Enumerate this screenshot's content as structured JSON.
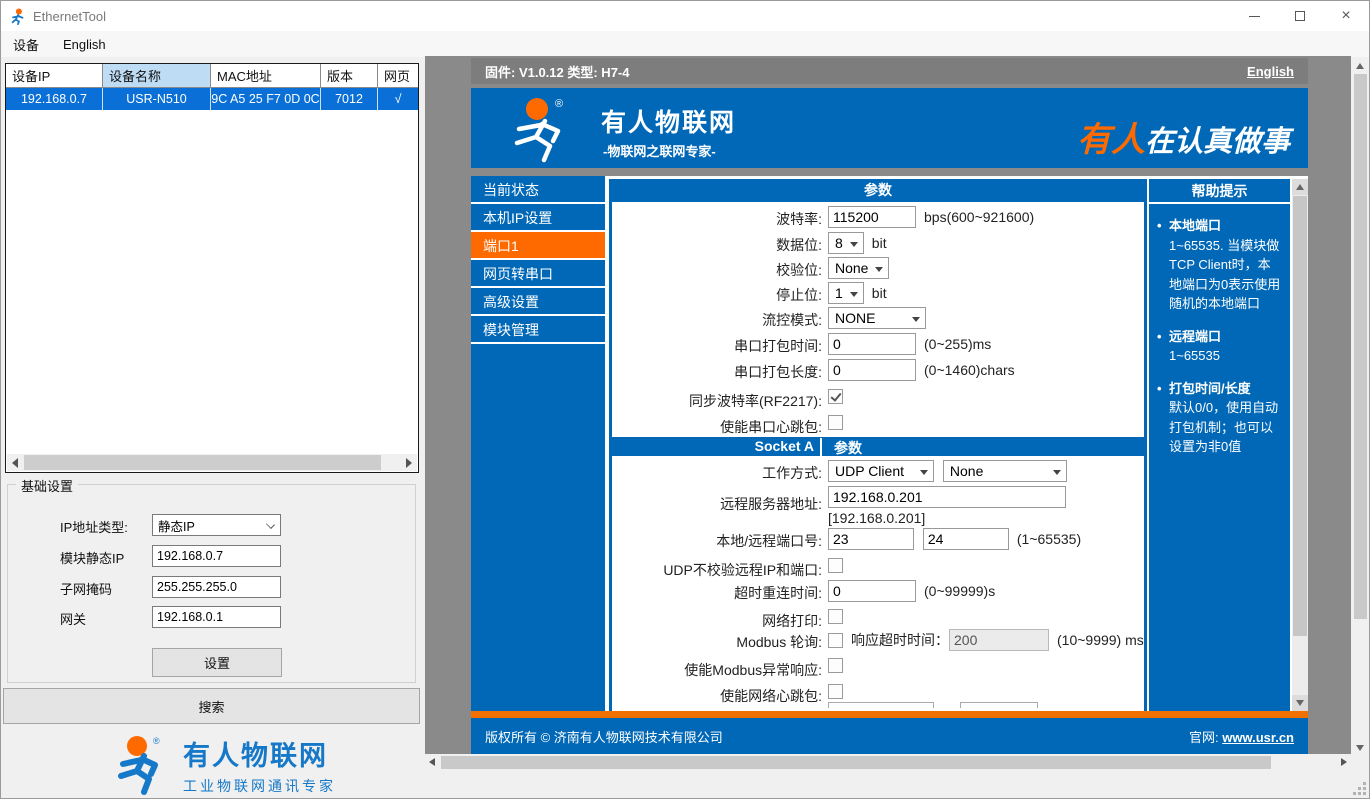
{
  "window": {
    "title": "EthernetTool",
    "menu": {
      "device": "设备",
      "english": "English"
    }
  },
  "device_table": {
    "headers": [
      "设备IP",
      "设备名称",
      "MAC地址",
      "版本",
      "网页"
    ],
    "row": {
      "ip": "192.168.0.7",
      "name": "USR-N510",
      "mac": "9C A5 25 F7 0D 0C",
      "version": "7012",
      "web": "√"
    }
  },
  "basic": {
    "title": "基础设置",
    "ip_type": {
      "label": "IP地址类型:",
      "value": "静态IP"
    },
    "static_ip": {
      "label": "模块静态IP",
      "value": "192.168.0.7"
    },
    "mask": {
      "label": "子网掩码",
      "value": "255.255.255.0"
    },
    "gateway": {
      "label": "网关",
      "value": "192.168.0.1"
    },
    "set_button": "设置",
    "search_button": "搜索",
    "logo": {
      "brand": "有人物联网",
      "tagline": "工业物联网通讯专家"
    }
  },
  "page": {
    "topbar": {
      "firmware": "固件: V1.0.12 类型: H7-4",
      "english": "English"
    },
    "header": {
      "brand": "有人物联网",
      "subtitle": "-物联网之联网专家-",
      "slogan_orange": "有人",
      "slogan_white": "在认真做事"
    },
    "nav": [
      {
        "label": "当前状态"
      },
      {
        "label": "本机IP设置"
      },
      {
        "label": "端口1",
        "active": true
      },
      {
        "label": "网页转串口"
      },
      {
        "label": "高级设置"
      },
      {
        "label": "模块管理"
      }
    ],
    "form": {
      "section1_title": "参数",
      "baud": {
        "label": "波特率:",
        "value": "115200",
        "hint": "bps(600~921600)"
      },
      "data_bits": {
        "label": "数据位:",
        "value": "8",
        "suffix": "bit"
      },
      "parity": {
        "label": "校验位:",
        "value": "None"
      },
      "stop_bits": {
        "label": "停止位:",
        "value": "1",
        "suffix": "bit"
      },
      "flow": {
        "label": "流控模式:",
        "value": "NONE"
      },
      "pack_time": {
        "label": "串口打包时间:",
        "value": "0",
        "hint": "(0~255)ms"
      },
      "pack_len": {
        "label": "串口打包长度:",
        "value": "0",
        "hint": "(0~1460)chars"
      },
      "sync_baud": {
        "label": "同步波特率(RF2217):",
        "checked": true
      },
      "serial_heartbeat": {
        "label": "使能串口心跳包:",
        "checked": false
      },
      "socket_title_left": "Socket A",
      "socket_title_right": "参数",
      "work_mode": {
        "label": "工作方式:",
        "value1": "UDP Client",
        "value2": "None"
      },
      "remote_addr": {
        "label": "远程服务器地址:",
        "value": "192.168.0.201",
        "resolved": "[192.168.0.201]"
      },
      "ports": {
        "label": "本地/远程端口号:",
        "local": "23",
        "remote": "24",
        "hint": "(1~65535)"
      },
      "udp_nocheck": {
        "label": "UDP不校验远程IP和端口:",
        "checked": false
      },
      "reconnect": {
        "label": "超时重连时间:",
        "value": "0",
        "hint": "(0~99999)s"
      },
      "net_print": {
        "label": "网络打印:",
        "checked": false
      },
      "modbus": {
        "label": "Modbus 轮询:",
        "checked": false,
        "sub_label": "响应超时时间：",
        "value": "200",
        "hint": "(10~9999) ms"
      },
      "modbus_exc": {
        "label": "使能Modbus异常响应:",
        "checked": false
      },
      "net_heartbeat": {
        "label": "使能网络心跳包:",
        "checked": false
      }
    },
    "help": {
      "title": "帮助提示",
      "items": [
        {
          "title": "本地端口",
          "body": "1~65535. 当模块做TCP Client时，本地端口为0表示使用随机的本地端口"
        },
        {
          "title": "远程端口",
          "body": "1~65535"
        },
        {
          "title": "打包时间/长度",
          "body": "默认0/0，使用自动打包机制；也可以设置为非0值"
        }
      ]
    },
    "footer": {
      "copyright": "版权所有 © 济南有人物联网技术有限公司",
      "site_label": "官网:",
      "site_link": "www.usr.cn"
    }
  },
  "colors": {
    "blue": "#0068b7",
    "orange": "#ff6a00",
    "logo_blue": "#1678c8",
    "selection_blue": "#0a70d8",
    "topbar_grey": "#7d7d7d"
  }
}
